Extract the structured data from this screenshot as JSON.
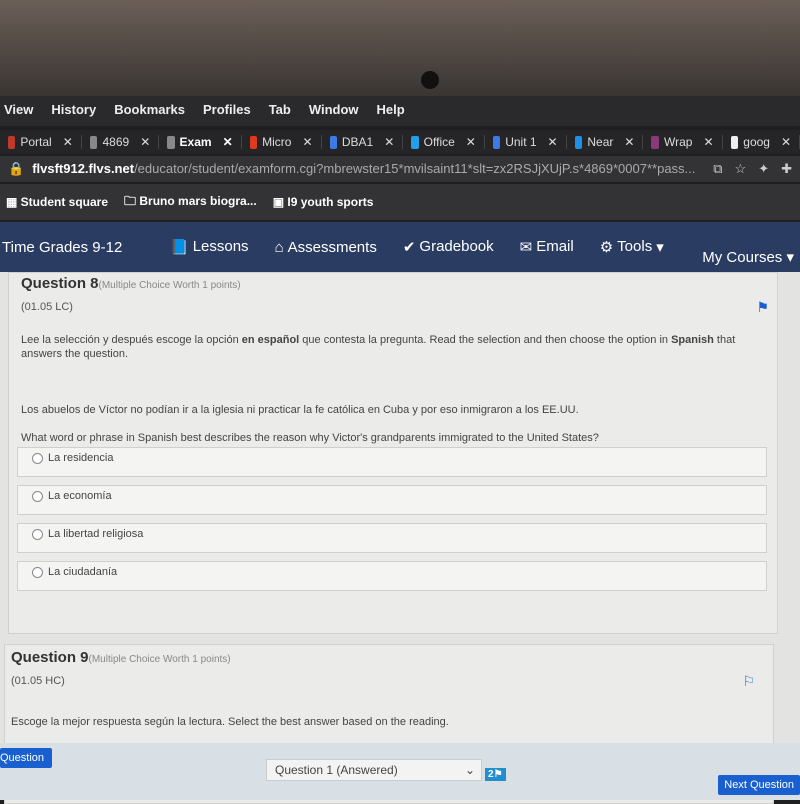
{
  "menu": [
    "View",
    "History",
    "Bookmarks",
    "Profiles",
    "Tab",
    "Window",
    "Help"
  ],
  "tabs": [
    {
      "label": "Portal",
      "color": "#c0392b"
    },
    {
      "label": "4869",
      "color": "#888"
    },
    {
      "label": "Exam",
      "color": "#888",
      "active": true
    },
    {
      "label": "Micro",
      "color": "#e03a1e"
    },
    {
      "label": "DBA1",
      "color": "#3b7be8"
    },
    {
      "label": "Office",
      "color": "#1fa0e8"
    },
    {
      "label": "Unit 1",
      "color": "#3b7be8"
    },
    {
      "label": "Near",
      "color": "#1f8fe8"
    },
    {
      "label": "Wrap",
      "color": "#8a3a7a"
    },
    {
      "label": "goog",
      "color": "#eee"
    }
  ],
  "address": {
    "domain": "flvsft912.flvs.net",
    "path": "/educator/student/examform.cgi?mbrewster15*mvilsaint11*slt=zx2RSJjXUjP.s*4869*0007**pass..."
  },
  "bookmarks": [
    "Student square",
    "Bruno mars biogra...",
    "I9 youth sports"
  ],
  "nav": {
    "brand": "Time Grades 9-12",
    "items": [
      "Lessons",
      "Assessments",
      "Gradebook",
      "Email",
      "Tools"
    ],
    "my_courses": "My Courses"
  },
  "q8": {
    "title": "Question 8",
    "meta": "(Multiple Choice Worth 1 points)",
    "code": "(01.05 LC)",
    "instr_pre": "Lee la selección y después escoge la opción ",
    "instr_bold": "en español",
    "instr_mid": " que contesta la pregunta. Read the selection and then choose the option in ",
    "instr_bold2": "Spanish",
    "instr_post": " that answers the question.",
    "passage": "Los abuelos de Víctor no podían ir a la iglesia ni practicar la fe católica en Cuba y por eso inmigraron a los EE.UU.",
    "question": "What word or phrase in Spanish best describes the reason why Victor's grandparents immigrated to the United States?",
    "options": [
      "La residencia",
      "La economía",
      "La libertad religiosa",
      "La ciudadanía"
    ]
  },
  "q9": {
    "title": "Question 9",
    "meta": "(Multiple Choice Worth 1 points)",
    "code": "(01.05 HC)",
    "instr": "Escoge la mejor respuesta según la lectura. Select the best answer based on the reading."
  },
  "footer": {
    "prev": "Question",
    "select": "Question 1 (Answered)",
    "flag_count": "2",
    "next": "Next Question"
  }
}
